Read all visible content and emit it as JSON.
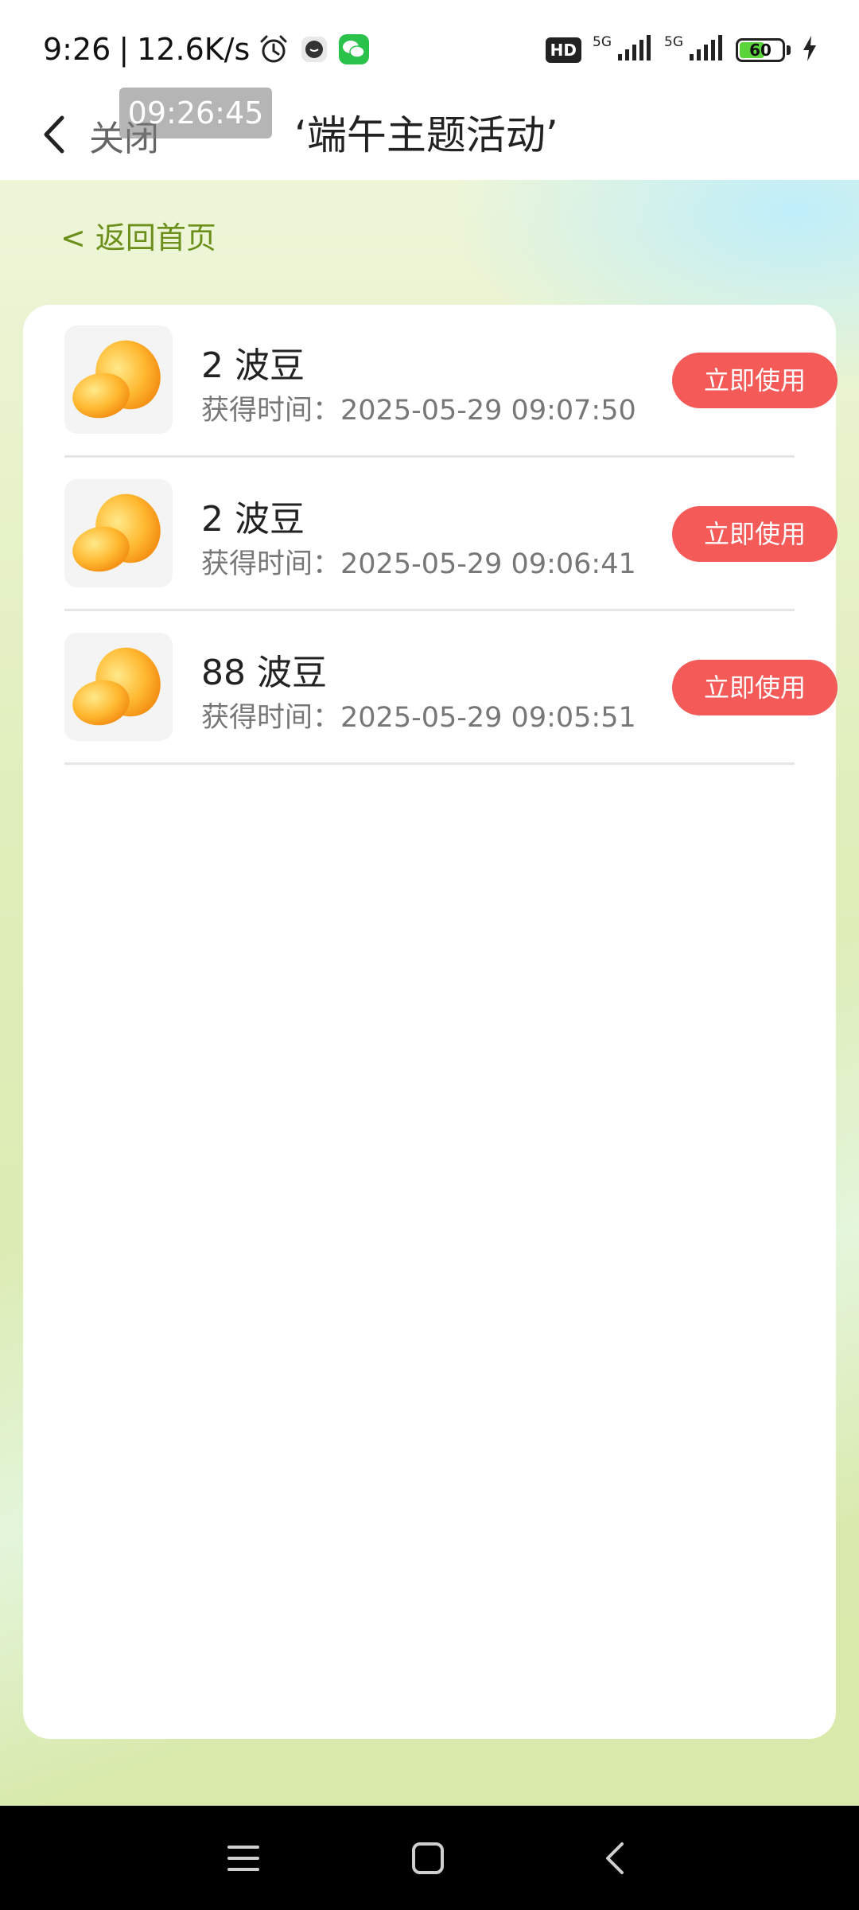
{
  "status_bar": {
    "time": "9:26",
    "separator": "|",
    "net_speed": "12.6K/s",
    "icons": [
      "alarm-icon",
      "app-icon",
      "wechat-icon"
    ],
    "hd_label": "HD",
    "network_1": "5G",
    "network_2": "5G",
    "battery_level": "60",
    "battery_fraction": 0.6,
    "charging": true
  },
  "title_bar": {
    "close_label": "关闭",
    "time_overlay": "09:26:45",
    "title": "‘端午主题活动’"
  },
  "home_link": "< 返回首页",
  "items": [
    {
      "title": "2 波豆",
      "time_label": "获得时间：",
      "time": "2025-05-29 09:07:50",
      "button": "立即使用"
    },
    {
      "title": "2 波豆",
      "time_label": "获得时间：",
      "time": "2025-05-29 09:06:41",
      "button": "立即使用"
    },
    {
      "title": "88 波豆",
      "time_label": "获得时间：",
      "time": "2025-05-29 09:05:51",
      "button": "立即使用"
    }
  ],
  "colors": {
    "accent_button": "#f45a58",
    "home_link": "#6b8f1a",
    "battery": "#5bd43c"
  },
  "nav_bar": {
    "icons": [
      "menu-icon",
      "home-icon",
      "back-icon"
    ]
  }
}
